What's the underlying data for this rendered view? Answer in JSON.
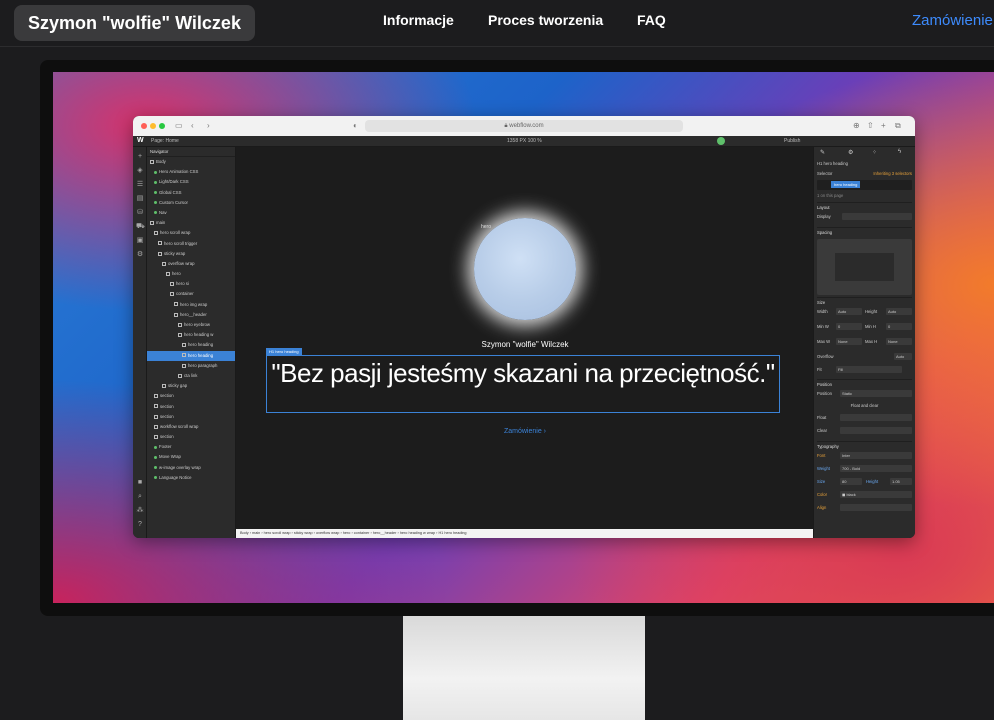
{
  "site": {
    "brand": "Szymon \"wolfie\" Wilczek",
    "nav": [
      "Informacje",
      "Proces tworzenia",
      "FAQ"
    ],
    "cta": "Zamówienie"
  },
  "browser": {
    "url": "webflow.com",
    "traffic_lights": [
      "#ff5f57",
      "#febc2e",
      "#28c840"
    ]
  },
  "webflow": {
    "page_label": "Page: Home",
    "canvas_size": "1358 PX  100 %",
    "publish": "Publish",
    "navigator": {
      "title": "Navigator",
      "rows": [
        "Body",
        "Hero Animation CSS",
        "Light/Dark CSS",
        "Global CSS",
        "Custom Cursor",
        "Nav",
        "main",
        "hero scroll wrap",
        "hero scroll trigger",
        "sticky wrap",
        "overflow wrap",
        "hero",
        "hero si",
        "container",
        "hero img wrap",
        "hero__header",
        "hero eyebrow",
        "hero heading w",
        "hero heading",
        "hero heading",
        "hero paragraph",
        "cta link",
        "sticky gap",
        "section",
        "section",
        "section",
        "workflow scroll wrap",
        "section",
        "Footer",
        "Move Wrap",
        "w-image overlay wrap",
        "Language Notice"
      ],
      "selected_index": 19
    },
    "canvas": {
      "image_alt": "hero",
      "name": "Szymon \"wolfie\" Wilczek",
      "tag": "H1 hero heading",
      "quote": "\"Bez pasji jesteśmy skazani na przeciętność.\"",
      "link": "Zamówienie ›",
      "breadcrumb": [
        "Body",
        "main",
        "hero scroll wrap",
        "sticky wrap",
        "overflow wrap",
        "hero",
        "container",
        "hero__header",
        "hero heading w wrap",
        "H1 hero heading"
      ]
    },
    "style_panel": {
      "element": "H1 hero heading",
      "selector_label": "Selector",
      "inheriting": "Inheriting 3 selectors",
      "class_chip": "hero heading",
      "on_page": "1 on this page",
      "sections": [
        "Layout",
        "Spacing",
        "Size",
        "Position",
        "Typography"
      ],
      "display_label": "Display",
      "width_label": "Width",
      "width_value": "Auto",
      "height_label": "Height",
      "height_value": "Auto",
      "minw_label": "Min W",
      "minw_value": "0",
      "minh_label": "Min H",
      "minh_value": "0",
      "maxw_label": "Max W",
      "maxw_value": "None",
      "maxh_label": "Max H",
      "maxh_value": "None",
      "overflow_label": "Overflow",
      "overflow_value": "Auto",
      "fit_label": "Fit",
      "fit_value": "Fill",
      "position_label": "Position",
      "position_value": "Static",
      "float_clear": "Float and clear",
      "float_label": "Float",
      "clear_label": "Clear",
      "font_label": "Font",
      "font_value": "Inter",
      "weight_label": "Weight",
      "weight_value": "700 - Bold",
      "size_label": "Size",
      "size_value": "80",
      "lineheight_label": "Height",
      "lineheight_value": "1.05",
      "color_label": "Color",
      "color_value": "black",
      "align_label": "Align"
    }
  }
}
